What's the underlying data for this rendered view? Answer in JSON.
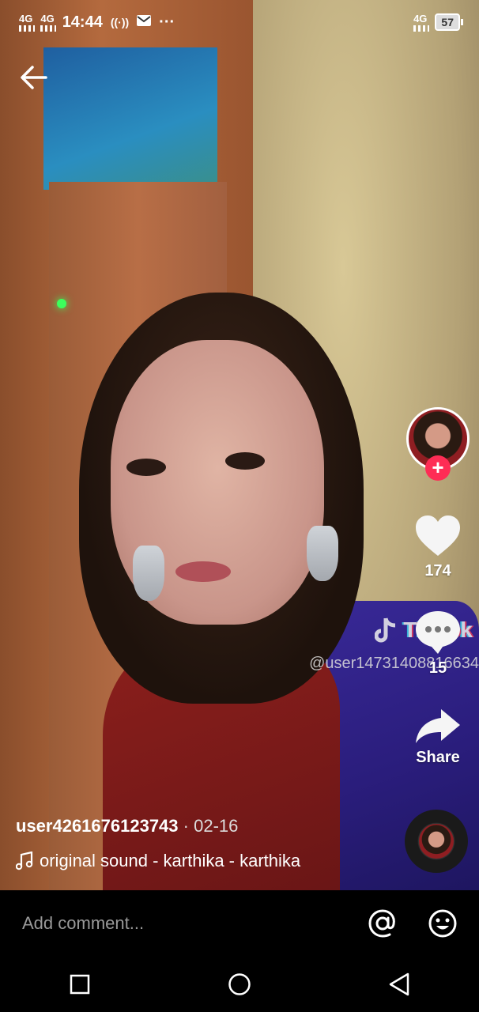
{
  "status_bar": {
    "net1": "4G",
    "net2": "4G",
    "time": "14:44",
    "more": "···",
    "net_right": "4G",
    "battery": "57"
  },
  "watermark": {
    "brand": "TikTok",
    "username": "@user14731408816634"
  },
  "actions": {
    "likes": "174",
    "comments": "15",
    "share_label": "Share"
  },
  "caption": {
    "username": "user4261676123743",
    "separator": " · ",
    "date": "02-16",
    "sound": "original sound - karthika - karthika"
  },
  "comment_bar": {
    "placeholder": "Add comment..."
  },
  "icons": {
    "back": "back-arrow-icon",
    "heart": "heart-icon",
    "comment": "comment-bubble-icon",
    "share": "share-arrow-icon",
    "mention": "at-sign-icon",
    "emoji": "emoji-icon",
    "music": "music-note-icon"
  },
  "colors": {
    "follow_accent": "#fe2c55",
    "background": "#000000"
  }
}
